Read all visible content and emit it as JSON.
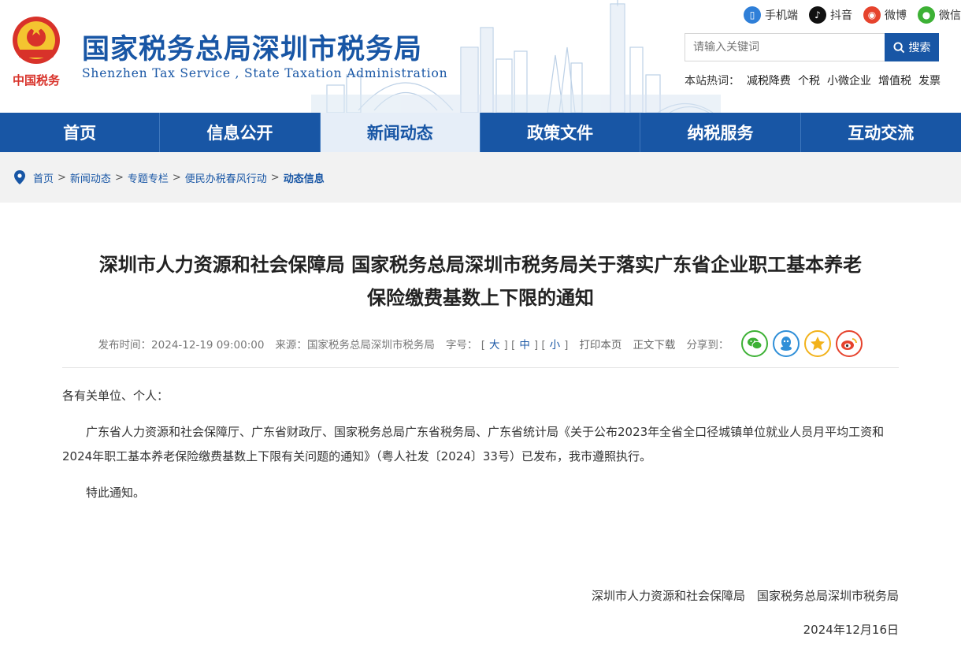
{
  "header": {
    "title": "国家税务总局深圳市税务局",
    "subtitle": "Shenzhen Tax Service , State Taxation Administration",
    "emblem_text": "中国税务",
    "social": [
      {
        "label": "手机端",
        "icon": "mobile-icon",
        "color": "#2f7fd8"
      },
      {
        "label": "抖音",
        "icon": "douyin-icon",
        "color": "#111111"
      },
      {
        "label": "微博",
        "icon": "weibo-icon",
        "color": "#e6432d"
      },
      {
        "label": "微信",
        "icon": "wechat-icon",
        "color": "#3db135"
      }
    ],
    "search": {
      "placeholder": "请输入关键词",
      "button": "搜索"
    },
    "hot_label": "本站热词：",
    "hot_words": [
      "减税降费",
      "个税",
      "小微企业",
      "增值税",
      "发票"
    ]
  },
  "nav": {
    "items": [
      "首页",
      "信息公开",
      "新闻动态",
      "政策文件",
      "纳税服务",
      "互动交流"
    ],
    "active_index": 2
  },
  "breadcrumb": {
    "items": [
      "首页",
      "新闻动态",
      "专题专栏",
      "便民办税春风行动"
    ],
    "current": "动态信息",
    "separator": ">"
  },
  "article": {
    "title_line1": "深圳市人力资源和社会保障局 国家税务总局深圳市税务局关于落实广东省企业职工基本养老",
    "title_line2": "保险缴费基数上下限的通知",
    "meta": {
      "publish_label": "发布时间：",
      "publish_time": "2024-12-19 09:00:00",
      "source_label": "来源：",
      "source": "国家税务总局深圳市税务局",
      "font_label": "字号：",
      "sizes": [
        "大",
        "中",
        "小"
      ],
      "print": "打印本页",
      "download": "正文下载",
      "share_label": "分享到："
    },
    "share": [
      {
        "icon": "wechat-share-icon",
        "color": "#3db135"
      },
      {
        "icon": "qq-share-icon",
        "color": "#2f8fd8"
      },
      {
        "icon": "qzone-share-icon",
        "color": "#f2b21a"
      },
      {
        "icon": "weibo-share-icon",
        "color": "#e6432d"
      }
    ],
    "salutation": "各有关单位、个人：",
    "paragraph": "广东省人力资源和社会保障厅、广东省财政厅、国家税务总局广东省税务局、广东省统计局《关于公布2023年全省全口径城镇单位就业人员月平均工资和2024年职工基本养老保险缴费基数上下限有关问题的通知》（粤人社发〔2024〕33号）已发布，我市遵照执行。",
    "closing": "特此通知。",
    "signatories": "深圳市人力资源和社会保障局　国家税务总局深圳市税务局",
    "date": "2024年12月16日"
  },
  "colors": {
    "brand": "#1856a5",
    "nav_active_bg": "#e6eef8",
    "breadcrumb_bg": "#f2f2f2"
  }
}
